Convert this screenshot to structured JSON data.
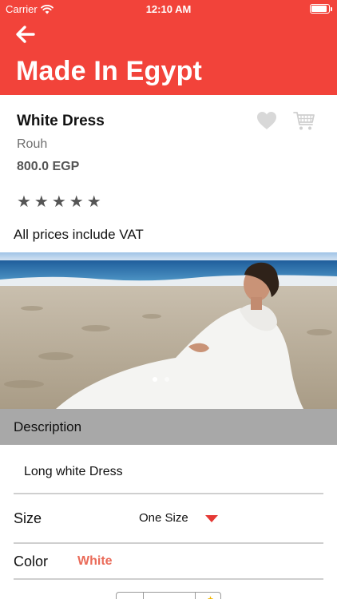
{
  "status_bar": {
    "carrier": "Carrier",
    "time": "12:10 AM",
    "icons": [
      "wifi-icon",
      "battery-icon"
    ]
  },
  "header": {
    "title": "Made In Egypt",
    "back_icon": "arrow-left-icon",
    "background_color": "#F2433A"
  },
  "product": {
    "name": "White Dress",
    "brand": "Rouh",
    "price": "800.0 EGP",
    "rating_stars": "★★★★★",
    "vat_note": "All prices include VAT",
    "actions": {
      "favorite_icon": "heart-icon",
      "cart_icon": "cart-icon"
    },
    "image": {
      "current_index": 1,
      "total": 2
    }
  },
  "description": {
    "header": "Description",
    "text": "Long white Dress"
  },
  "options": {
    "size_label": "Size",
    "size_value": "One Size",
    "color_label": "Color",
    "color_value": "White",
    "color_accent": "#EA6B59"
  }
}
